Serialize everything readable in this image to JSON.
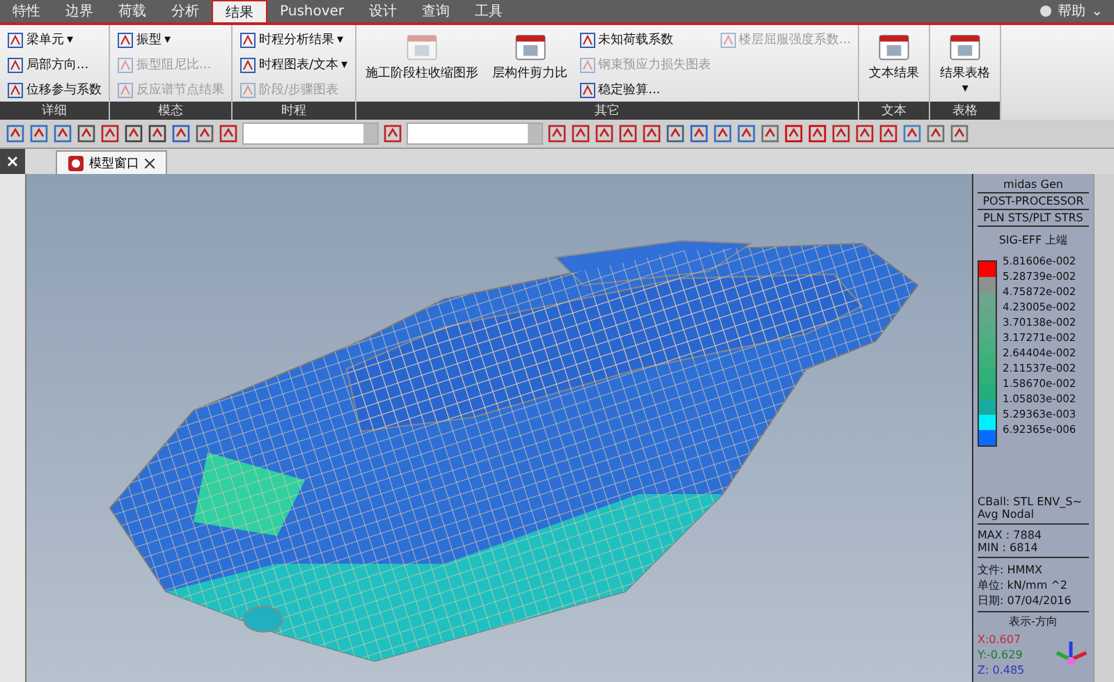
{
  "menu_tabs": [
    {
      "label": "特性",
      "selected": false
    },
    {
      "label": "边界",
      "selected": false
    },
    {
      "label": "荷载",
      "selected": false
    },
    {
      "label": "分析",
      "selected": false
    },
    {
      "label": "结果",
      "selected": true
    },
    {
      "label": "Pushover",
      "selected": false
    },
    {
      "label": "设计",
      "selected": false
    },
    {
      "label": "查询",
      "selected": false
    },
    {
      "label": "工具",
      "selected": false
    }
  ],
  "help": {
    "label": "帮助",
    "caret": "⌄"
  },
  "ribbon_groups": [
    {
      "title": "详细",
      "items": [
        {
          "kind": "small",
          "label": "梁单元",
          "caret": "▾",
          "disabled": false
        },
        {
          "kind": "small",
          "label": "局部方向...",
          "disabled": false
        },
        {
          "kind": "small",
          "label": "位移参与系数",
          "disabled": false
        }
      ]
    },
    {
      "title": "模态",
      "items": [
        {
          "kind": "small",
          "label": "振型",
          "caret": "▾",
          "disabled": false
        },
        {
          "kind": "small",
          "label": "振型阻尼比...",
          "disabled": true
        },
        {
          "kind": "small",
          "label": "反应谱节点结果",
          "disabled": true
        }
      ]
    },
    {
      "title": "时程",
      "items": [
        {
          "kind": "small",
          "label": "时程分析结果",
          "caret": "▾",
          "disabled": false
        },
        {
          "kind": "small",
          "label": "时程图表/文本",
          "caret": "▾",
          "disabled": false
        },
        {
          "kind": "small",
          "label": "阶段/步骤图表",
          "disabled": true
        }
      ]
    },
    {
      "title": "其它",
      "items": [
        {
          "kind": "large",
          "label": "施工阶段柱收缩图形",
          "disabled": true
        },
        {
          "kind": "large",
          "label": "层构件剪力比",
          "disabled": false
        },
        {
          "kind": "small",
          "label": "未知荷载系数",
          "disabled": false
        },
        {
          "kind": "small",
          "label": "钢束预应力损失图表",
          "disabled": true
        },
        {
          "kind": "small",
          "label": "稳定验算...",
          "disabled": false
        },
        {
          "kind": "small",
          "label": "楼层屈服强度系数...",
          "disabled": true
        }
      ]
    },
    {
      "title": "文本",
      "items": [
        {
          "kind": "large",
          "label": "文本结果",
          "disabled": false
        }
      ]
    },
    {
      "title": "表格",
      "items": [
        {
          "kind": "large",
          "label": "结果表格",
          "caret": "▾",
          "disabled": false
        }
      ]
    }
  ],
  "doc_tab": {
    "label": "模型窗口",
    "selected": true
  },
  "legend": {
    "header": [
      "midas Gen",
      "POST-PROCESSOR",
      "PLN STS/PLT STRS"
    ],
    "component": "SIG-EFF 上端",
    "bands": [
      {
        "color": "#ff0000"
      },
      {
        "color": "#8c9190"
      },
      {
        "color": "#6fa48e"
      },
      {
        "color": "#62a98a"
      },
      {
        "color": "#55ad85"
      },
      {
        "color": "#48b07f"
      },
      {
        "color": "#3db17a"
      },
      {
        "color": "#30b078"
      },
      {
        "color": "#24ae7e"
      },
      {
        "color": "#1aaaa0"
      },
      {
        "color": "#00f0ff"
      },
      {
        "color": "#0a6cff"
      }
    ],
    "values": [
      "5.81606e-002",
      "5.28739e-002",
      "4.75872e-002",
      "4.23005e-002",
      "3.70138e-002",
      "3.17271e-002",
      "2.64404e-002",
      "2.11537e-002",
      "1.58670e-002",
      "1.05803e-002",
      "5.29363e-003",
      "6.92365e-006"
    ],
    "case": [
      "CBall: STL ENV_S~",
      "Avg Nodal"
    ],
    "minmax": [
      "MAX : 7884",
      "MIN : 6814"
    ],
    "info": [
      "文件: HMMX",
      "单位: kN/mm ^2",
      "日期: 07/04/2016"
    ],
    "direction_title": "表示-方向",
    "axes": [
      {
        "label": "X:0.607",
        "color": "#c02838"
      },
      {
        "label": "Y:-0.629",
        "color": "#157a25"
      },
      {
        "label": "Z: 0.485",
        "color": "#2a38b8"
      }
    ]
  }
}
